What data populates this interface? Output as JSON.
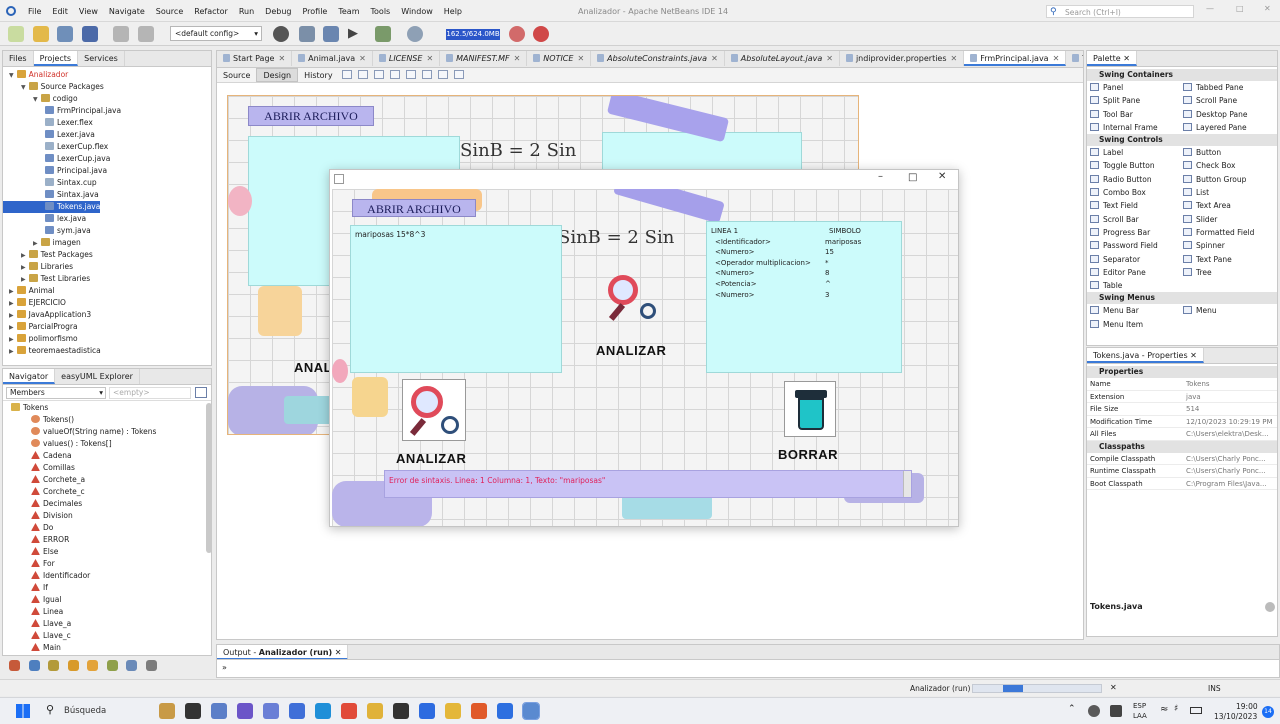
{
  "window": {
    "title": "Analizador - Apache NetBeans IDE 14",
    "menu": [
      "File",
      "Edit",
      "View",
      "Navigate",
      "Source",
      "Refactor",
      "Run",
      "Debug",
      "Profile",
      "Team",
      "Tools",
      "Window",
      "Help"
    ],
    "search_placeholder": "Search (Ctrl+I)"
  },
  "toolbar": {
    "config": "<default config>",
    "memory": "162.5/624.0MB"
  },
  "projects": {
    "tabs": [
      "Files",
      "Projects",
      "Services"
    ],
    "tree": [
      {
        "label": "Analizador",
        "depth": 0,
        "kind": "project-root",
        "color": "#d0322a"
      },
      {
        "label": "Source Packages",
        "depth": 1,
        "kind": "folder"
      },
      {
        "label": "codigo",
        "depth": 2,
        "kind": "package"
      },
      {
        "label": "FrmPrincipal.java",
        "depth": 3,
        "kind": "java"
      },
      {
        "label": "Lexer.flex",
        "depth": 3,
        "kind": "file"
      },
      {
        "label": "Lexer.java",
        "depth": 3,
        "kind": "java"
      },
      {
        "label": "LexerCup.flex",
        "depth": 3,
        "kind": "file"
      },
      {
        "label": "LexerCup.java",
        "depth": 3,
        "kind": "java"
      },
      {
        "label": "Principal.java",
        "depth": 3,
        "kind": "java"
      },
      {
        "label": "Sintax.cup",
        "depth": 3,
        "kind": "file"
      },
      {
        "label": "Sintax.java",
        "depth": 3,
        "kind": "java"
      },
      {
        "label": "Tokens.java",
        "depth": 3,
        "kind": "java",
        "selected": true
      },
      {
        "label": "lex.java",
        "depth": 3,
        "kind": "java"
      },
      {
        "label": "sym.java",
        "depth": 3,
        "kind": "java"
      },
      {
        "label": "imagen",
        "depth": 2,
        "kind": "package"
      },
      {
        "label": "Test Packages",
        "depth": 1,
        "kind": "folder"
      },
      {
        "label": "Libraries",
        "depth": 1,
        "kind": "folder"
      },
      {
        "label": "Test Libraries",
        "depth": 1,
        "kind": "folder"
      },
      {
        "label": "Animal",
        "depth": 0,
        "kind": "project"
      },
      {
        "label": "EJERCICIO",
        "depth": 0,
        "kind": "project"
      },
      {
        "label": "JavaApplication3",
        "depth": 0,
        "kind": "project"
      },
      {
        "label": "ParcialProgra",
        "depth": 0,
        "kind": "project"
      },
      {
        "label": "polimorfismo",
        "depth": 0,
        "kind": "project"
      },
      {
        "label": "teoremaestadistica",
        "depth": 0,
        "kind": "project"
      }
    ]
  },
  "navigator": {
    "tabs": [
      "Navigator",
      "easyUML Explorer"
    ],
    "members_label": "Members",
    "filter_placeholder": "<empty>",
    "root": "Tokens",
    "items": [
      "Tokens()",
      "valueOf(String name) : Tokens",
      "values() : Tokens[]",
      "Cadena",
      "Comillas",
      "Corchete_a",
      "Corchete_c",
      "Decimales",
      "Division",
      "Do",
      "ERROR",
      "Else",
      "For",
      "Identificador",
      "If",
      "Igual",
      "Linea",
      "Llave_a",
      "Llave_c",
      "Main"
    ]
  },
  "editor": {
    "tabs": [
      "Start Page",
      "Animal.java",
      "LICENSE",
      "MANIFEST.MF",
      "NOTICE",
      "AbsoluteConstraints.java",
      "AbsoluteLayout.java",
      "jndiprovider.properties",
      "FrmPrincipal.java",
      "Tokens.java..."
    ],
    "active_tab": "FrmPrincipal.java",
    "subtabs": [
      "Source",
      "Design",
      "History"
    ],
    "active_subtab": "Design"
  },
  "form_bg": {
    "abrir": "ABRIR ARCHIVO",
    "analizar": "ANAL",
    "formula": "SinB = 2 Sin"
  },
  "app": {
    "abrir": "ABRIR ARCHIVO",
    "input_text": "mariposas 15*8^3",
    "analizar": "ANALIZAR",
    "analizar2": "ANALIZAR",
    "borrar": "BORRAR",
    "formula": "SinB = 2 Sin",
    "header": {
      "left": "LINEA 1",
      "right": "SIMBOLO"
    },
    "tokens": [
      {
        "k": "<Identificador>",
        "v": "mariposas"
      },
      {
        "k": "<Numero>",
        "v": "15"
      },
      {
        "k": "<Operador multiplicacion>",
        "v": "*"
      },
      {
        "k": "<Numero>",
        "v": "8"
      },
      {
        "k": "<Potencia>",
        "v": "^"
      },
      {
        "k": "<Numero>",
        "v": "3"
      }
    ],
    "error": "Error de sintaxis. Linea: 1 Columna: 1, Texto: \"mariposas\""
  },
  "palette": {
    "title": "Palette",
    "sections": [
      {
        "name": "Swing Containers",
        "items": [
          "Panel",
          "Tabbed Pane",
          "Split Pane",
          "Scroll Pane",
          "Tool Bar",
          "Desktop Pane",
          "Internal Frame",
          "Layered Pane"
        ]
      },
      {
        "name": "Swing Controls",
        "items": [
          "Label",
          "Button",
          "Toggle Button",
          "Check Box",
          "Radio Button",
          "Button Group",
          "Combo Box",
          "List",
          "Text Field",
          "Text Area",
          "Scroll Bar",
          "Slider",
          "Progress Bar",
          "Formatted Field",
          "Password Field",
          "Spinner",
          "Separator",
          "Text Pane",
          "Editor Pane",
          "Tree",
          "Table"
        ]
      },
      {
        "name": "Swing Menus",
        "items": [
          "Menu Bar",
          "Menu",
          "Menu Item"
        ]
      }
    ]
  },
  "properties": {
    "title": "Tokens.java - Properties",
    "section": "Properties",
    "rows": [
      {
        "k": "Name",
        "v": "Tokens"
      },
      {
        "k": "Extension",
        "v": "java"
      },
      {
        "k": "File Size",
        "v": "514"
      },
      {
        "k": "Modification Time",
        "v": "12/10/2023 10:29:19 PM"
      },
      {
        "k": "All Files",
        "v": "C:\\Users\\elektra\\Desk..."
      }
    ],
    "section2": "Classpaths",
    "rows2": [
      {
        "k": "Compile Classpath",
        "v": "C:\\Users\\Charly Ponc..."
      },
      {
        "k": "Runtime Classpath",
        "v": "C:\\Users\\Charly Ponc..."
      },
      {
        "k": "Boot Classpath",
        "v": "C:\\Program Files\\Java..."
      }
    ],
    "footer": "Tokens.java"
  },
  "output": {
    "label": "Output - ",
    "bold": "Analizador (run)"
  },
  "status": {
    "task": "Analizador (run)",
    "mode": "INS"
  },
  "taskbar": {
    "search": "Búsqueda",
    "lang1": "ESP",
    "lang2": "LAA",
    "time": "19:00",
    "date": "13/10/2023",
    "badge": "14"
  }
}
